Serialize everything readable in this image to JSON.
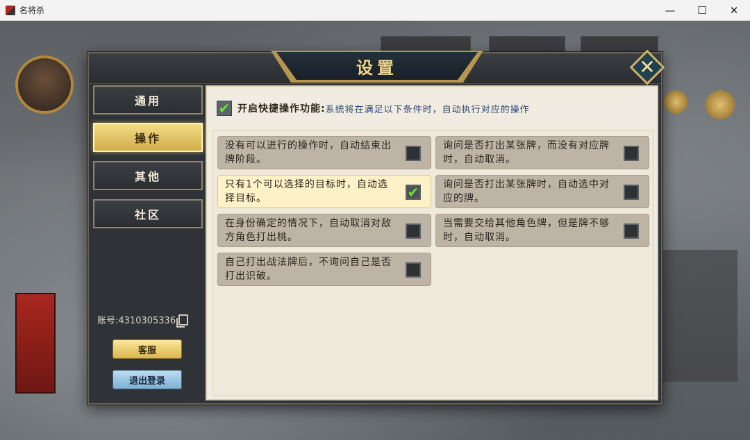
{
  "window": {
    "title": "名将杀",
    "minimize": "—",
    "maximize": "☐",
    "close": "✕"
  },
  "dialog": {
    "title": "设置",
    "close_glyph": "✕"
  },
  "sidebar": {
    "items": [
      {
        "label": "通用",
        "active": false
      },
      {
        "label": "操作",
        "active": true
      },
      {
        "label": "其他",
        "active": false
      },
      {
        "label": "社区",
        "active": false
      }
    ],
    "account": "账号:4310305336",
    "service_label": "客服",
    "logout_label": "退出登录"
  },
  "quick": {
    "checked": true,
    "check_glyph": "✔",
    "label": "开启快捷操作功能:",
    "description": "系统将在满足以下条件时，自动执行对应的操作"
  },
  "options": [
    {
      "text": "没有可以进行的操作时，自动结束出牌阶段。",
      "checked": false
    },
    {
      "text": "询问是否打出某张牌，而没有对应牌时，自动取消。",
      "checked": false
    },
    {
      "text": "只有1个可以选择的目标时，自动选择目标。",
      "checked": true,
      "check_glyph": "✔"
    },
    {
      "text": "询问是否打出某张牌时，自动选中对应的牌。",
      "checked": false
    },
    {
      "text": "在身份确定的情况下，自动取消对敌方角色打出桃。",
      "checked": false
    },
    {
      "text": "当需要交给其他角色牌，但是牌不够时，自动取消。",
      "checked": false
    },
    {
      "text": "自己打出战法牌后，不询问自己是否打出识破。",
      "checked": false
    }
  ]
}
